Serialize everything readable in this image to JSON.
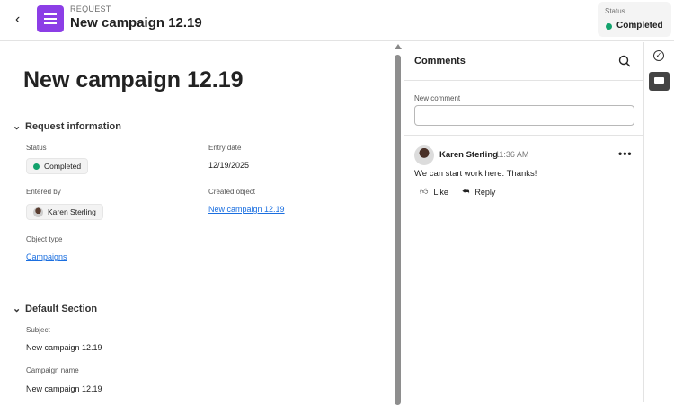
{
  "header": {
    "eyebrow": "REQUEST",
    "title": "New campaign 12.19",
    "status_label": "Status",
    "status_value": "Completed"
  },
  "main": {
    "title": "New campaign 12.19",
    "sections": [
      {
        "title": "Request information",
        "fields": {
          "status_label": "Status",
          "status_value": "Completed",
          "entry_date_label": "Entry date",
          "entry_date_value": "12/19/2025",
          "entered_by_label": "Entered by",
          "entered_by_value": "Karen Sterling",
          "created_object_label": "Created object",
          "created_object_value": "New campaign 12.19",
          "object_type_label": "Object type",
          "object_type_value": "Campaigns"
        }
      },
      {
        "title": "Default Section",
        "fields": {
          "subject_label": "Subject",
          "subject_value": "New campaign 12.19",
          "campaign_name_label": "Campaign name",
          "campaign_name_value": "New campaign 12.19"
        }
      }
    ]
  },
  "comments": {
    "title": "Comments",
    "new_comment_label": "New comment",
    "new_comment_value": "",
    "items": [
      {
        "author": "Karen Sterling",
        "time": "11:36 AM",
        "text": "We can start work here. Thanks!",
        "like_label": "Like",
        "reply_label": "Reply"
      }
    ]
  },
  "colors": {
    "accent": "#8c3ee6",
    "status_green": "#12a26c",
    "link": "#1b6fe0"
  }
}
